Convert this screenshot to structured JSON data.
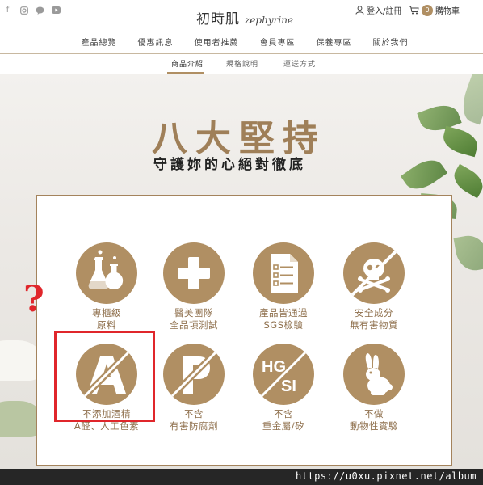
{
  "header": {
    "brand_cn": "初時肌",
    "brand_en": "zephyrine",
    "account_label": "登入/註冊",
    "cart_count": "0",
    "cart_label": "購物車",
    "socials": [
      "facebook-icon",
      "instagram-icon",
      "line-icon",
      "youtube-icon"
    ]
  },
  "nav": {
    "items": [
      "產品總覽",
      "優惠訊息",
      "使用者推薦",
      "會員專區",
      "保養專區",
      "關於我們"
    ]
  },
  "subtabs": {
    "items": [
      "商品介紹",
      "規格說明",
      "運送方式"
    ],
    "active": "商品介紹"
  },
  "hero": {
    "title": "八大堅持",
    "subtitle": "守護妳的心絕對徹底"
  },
  "features": [
    {
      "icon": "flask-icon",
      "line1": "專櫃級",
      "line2": "原料"
    },
    {
      "icon": "medical-cross-icon",
      "line1": "醫美團隊",
      "line2": "全品項測試"
    },
    {
      "icon": "document-check-icon",
      "line1": "產品皆通過",
      "line2": "SGS檢驗"
    },
    {
      "icon": "no-toxic-icon",
      "line1": "安全成分",
      "line2": "無有害物質"
    },
    {
      "icon": "no-alcohol-icon",
      "line1": "不添加酒精",
      "line2": "A醛、人工色素"
    },
    {
      "icon": "no-paraben-icon",
      "line1": "不含",
      "line2": "有害防腐劑"
    },
    {
      "icon": "no-heavy-metal-icon",
      "line1": "不含",
      "line2": "重金屬/矽",
      "badge_top": "HG",
      "badge_bottom": "SI"
    },
    {
      "icon": "no-animal-testing-icon",
      "line1": "不做",
      "line2": "動物性實驗"
    }
  ],
  "annotation": {
    "question_mark": "?"
  },
  "watermark": "https://u0xu.pixnet.net/album",
  "colors": {
    "accent": "#b08f63",
    "annotation_red": "#e0262b"
  }
}
